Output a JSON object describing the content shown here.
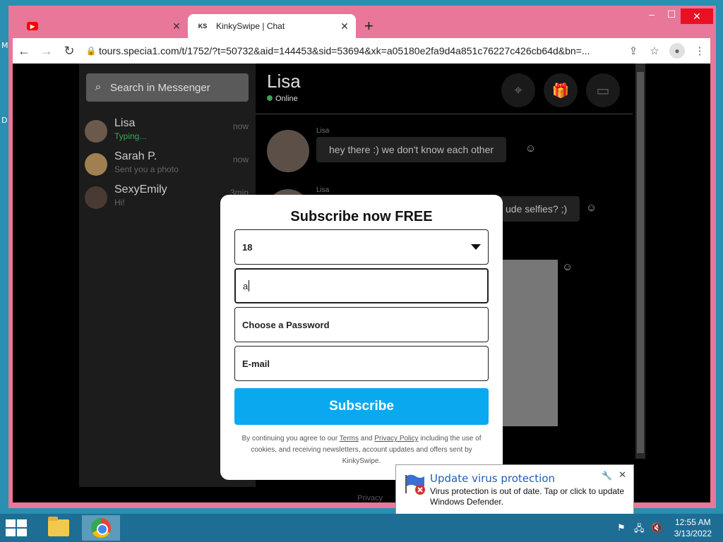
{
  "desktop": {
    "edge_letters": [
      "M",
      "D"
    ]
  },
  "browser": {
    "tabs": [
      {
        "title": "",
        "favicon": "youtube-icon",
        "active": false
      },
      {
        "title": "KinkySwipe | Chat",
        "favicon": "KS",
        "active": true
      }
    ],
    "new_tab": "+",
    "window_controls": {
      "minimize": "–",
      "maximize": "☐",
      "close": "✕"
    },
    "url": "tours.specia1.com/t/1752/?t=50732&aid=144453&sid=53694&xk=a05180e2fa9d4a851c76227c426cb64d&bn=..."
  },
  "messenger": {
    "search_placeholder": "Search in Messenger",
    "contacts": [
      {
        "name": "Lisa",
        "sub": "Typing...",
        "time": "now"
      },
      {
        "name": "Sarah P.",
        "sub": "Sent you a photo",
        "time": "now"
      },
      {
        "name": "SexyEmily",
        "sub": "Hi!",
        "time": "3min"
      }
    ],
    "chat": {
      "name": "Lisa",
      "status": "Online",
      "messages": [
        {
          "from": "Lisa",
          "text": "hey there :) we don't know each other"
        },
        {
          "from": "Lisa",
          "text": "ude selfies? ;)"
        }
      ],
      "footer": "Privacy"
    }
  },
  "modal": {
    "title": "Subscribe now FREE",
    "age_value": "18",
    "username_value": "a",
    "password_placeholder": "Choose a Password",
    "email_placeholder": "E-mail",
    "submit_label": "Subscribe",
    "legal_prefix": "By continuing you agree to our",
    "terms_label": "Terms",
    "and": "and",
    "privacy_label": "Privacy Policy",
    "legal_suffix": "including the use of cookies, and receiving newsletters, account updates and offers sent by KinkySwipe."
  },
  "defender_balloon": {
    "title": "Update virus protection",
    "text": "Virus protection is out of date. Tap or click to update Windows Defender."
  },
  "taskbar": {
    "time": "12:55 AM",
    "date": "3/13/2022"
  }
}
